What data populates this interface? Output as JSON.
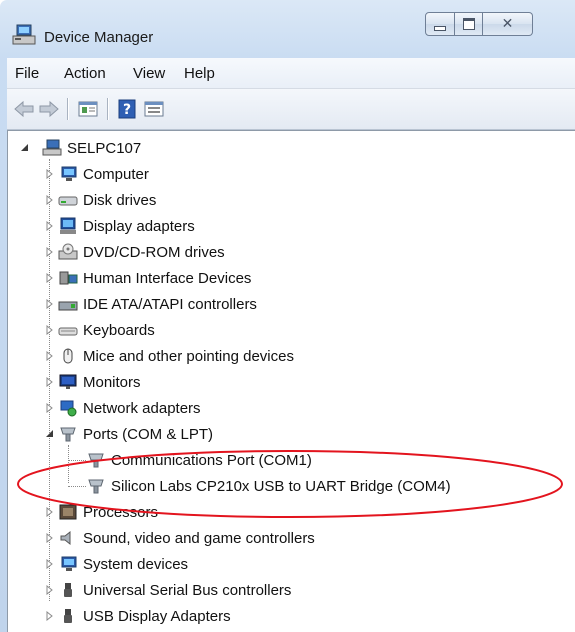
{
  "window": {
    "title": "Device Manager",
    "controls": {
      "minimize": "minimize",
      "maximize": "maximize",
      "close": "close"
    }
  },
  "menu": [
    "File",
    "Action",
    "View",
    "Help"
  ],
  "toolbar": {
    "buttons": [
      "back-arrow-icon",
      "forward-arrow-icon",
      "properties-icon",
      "help-icon",
      "update-driver-icon"
    ]
  },
  "tree": {
    "root": "SELPC107",
    "categories": [
      {
        "label": "Computer",
        "icon": "computer-icon",
        "expanded": false
      },
      {
        "label": "Disk drives",
        "icon": "disk-drive-icon",
        "expanded": false
      },
      {
        "label": "Display adapters",
        "icon": "display-adapter-icon",
        "expanded": false
      },
      {
        "label": "DVD/CD-ROM drives",
        "icon": "dvd-drive-icon",
        "expanded": false
      },
      {
        "label": "Human Interface Devices",
        "icon": "hid-icon",
        "expanded": false
      },
      {
        "label": "IDE ATA/ATAPI controllers",
        "icon": "ide-controller-icon",
        "expanded": false
      },
      {
        "label": "Keyboards",
        "icon": "keyboard-icon",
        "expanded": false
      },
      {
        "label": "Mice and other pointing devices",
        "icon": "mouse-icon",
        "expanded": false
      },
      {
        "label": "Monitors",
        "icon": "monitor-icon",
        "expanded": false
      },
      {
        "label": "Network adapters",
        "icon": "network-adapter-icon",
        "expanded": false
      },
      {
        "label": "Ports (COM & LPT)",
        "icon": "port-icon",
        "expanded": true,
        "children": [
          {
            "label": "Communications Port (COM1)",
            "icon": "port-icon"
          },
          {
            "label": "Silicon Labs CP210x USB to UART Bridge (COM4)",
            "icon": "port-icon"
          }
        ]
      },
      {
        "label": "Processors",
        "icon": "processor-icon",
        "expanded": false
      },
      {
        "label": "Sound, video and game controllers",
        "icon": "speaker-icon",
        "expanded": false
      },
      {
        "label": "System devices",
        "icon": "system-device-icon",
        "expanded": false
      },
      {
        "label": "Universal Serial Bus controllers",
        "icon": "usb-icon",
        "expanded": false
      },
      {
        "label": "USB Display Adapters",
        "icon": "usb-icon",
        "expanded": false
      }
    ]
  },
  "annotation": {
    "color": "#e3141e"
  }
}
